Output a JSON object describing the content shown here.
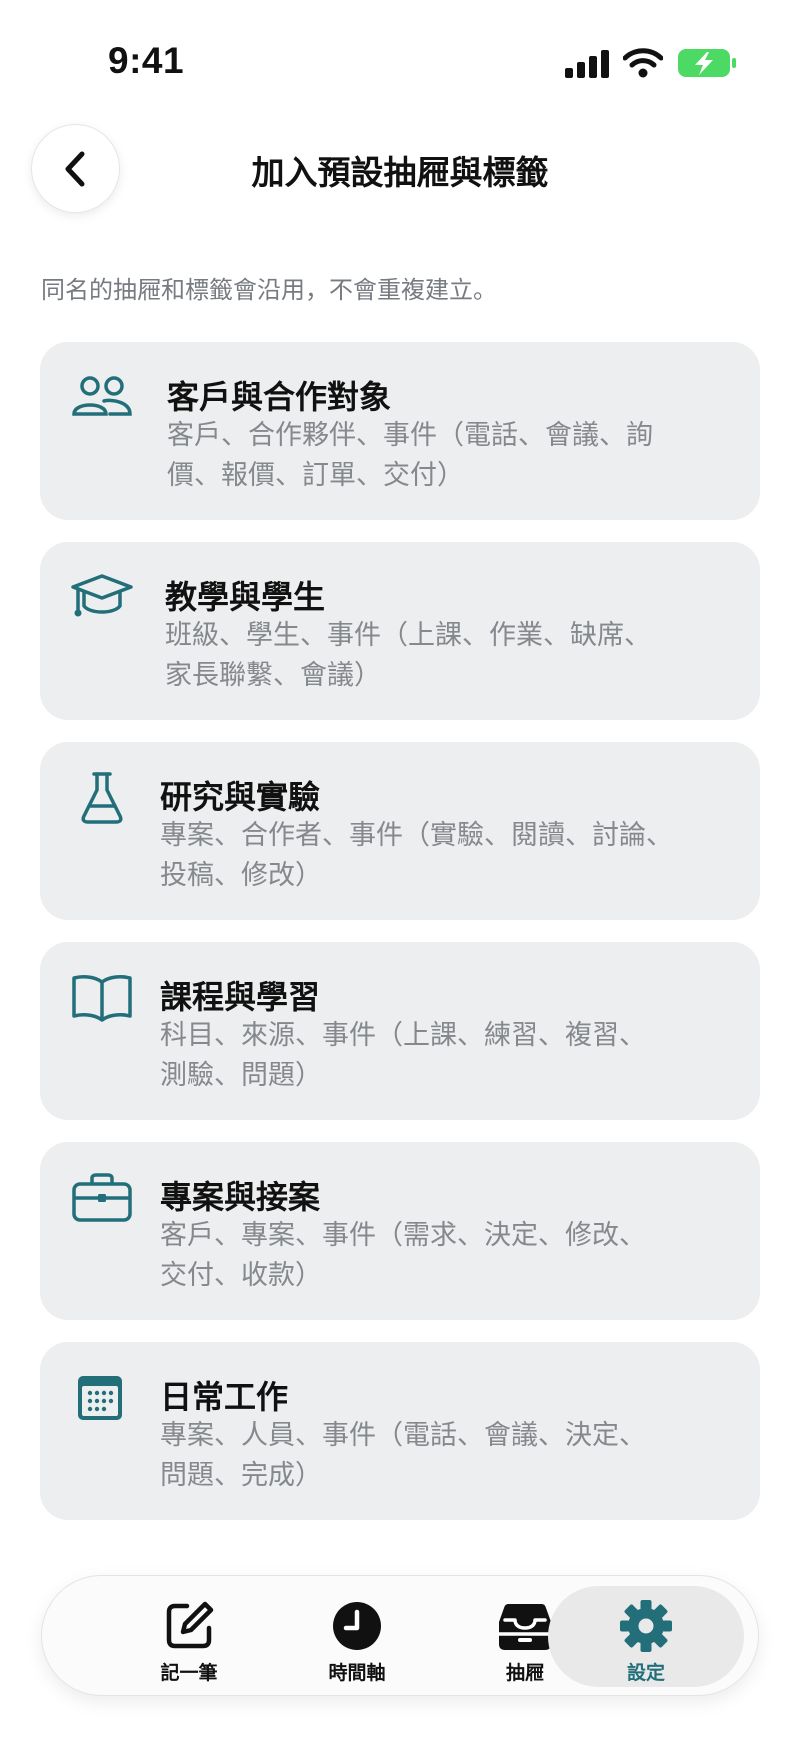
{
  "status_bar": {
    "time": "9:41"
  },
  "header": {
    "title": "加入預設抽屜與標籤"
  },
  "subtitle": "同名的抽屜和標籤會沿用，不會重複建立。",
  "accent_color": "#226f7a",
  "presets": [
    {
      "icon": "people-icon",
      "title": "客戶與合作對象",
      "line1": "客戶、合作夥伴、事件（電話、會議、詢",
      "line2": "價、報價、訂單、交付）"
    },
    {
      "icon": "graduation-cap-icon",
      "title": "教學與學生",
      "line1": "班級、學生、事件（上課、作業、缺席、",
      "line2": "家長聯繫、會議）"
    },
    {
      "icon": "flask-icon",
      "title": "研究與實驗",
      "line1": "專案、合作者、事件（實驗、閱讀、討論、",
      "line2": "投稿、修改）"
    },
    {
      "icon": "book-icon",
      "title": "課程與學習",
      "line1": "科目、來源、事件（上課、練習、複習、",
      "line2": "測驗、問題）"
    },
    {
      "icon": "briefcase-icon",
      "title": "專案與接案",
      "line1": "客戶、專案、事件（需求、決定、修改、",
      "line2": "交付、收款）"
    },
    {
      "icon": "calendar-icon",
      "title": "日常工作",
      "line1": "專案、人員、事件（電話、會議、決定、",
      "line2": "問題、完成）"
    }
  ],
  "tab_bar": {
    "tabs": [
      {
        "label": "記一筆",
        "icon": "compose-icon",
        "active": false
      },
      {
        "label": "時間軸",
        "icon": "clock-icon",
        "active": false
      },
      {
        "label": "抽屜",
        "icon": "tray-icon",
        "active": false
      },
      {
        "label": "設定",
        "icon": "gear-icon",
        "active": true
      }
    ]
  }
}
